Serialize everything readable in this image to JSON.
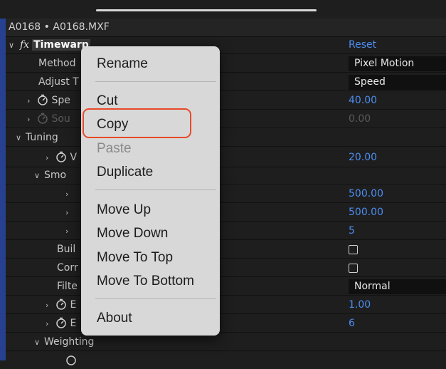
{
  "header": {
    "title": "A0168 • A0168.MXF"
  },
  "effect": {
    "fx_icon": "fx",
    "name": "Timewarp",
    "reset_label": "Reset"
  },
  "props": {
    "method": {
      "label": "Method",
      "value": "Pixel Motion"
    },
    "adjust": {
      "label": "Adjust T",
      "value": "Speed"
    },
    "speed": {
      "label": "Spe",
      "value": "40.00"
    },
    "source": {
      "label": "Sou",
      "value": "0.00"
    },
    "tuning": {
      "label": "Tuning"
    },
    "vector": {
      "label": "V",
      "value": "20.00"
    },
    "smooth": {
      "label": "Smo"
    },
    "sm1": {
      "value": "500.00"
    },
    "sm2": {
      "value": "500.00"
    },
    "sm3": {
      "value": "5"
    },
    "build": {
      "label": "Buil"
    },
    "correct": {
      "label": "Corr"
    },
    "filter": {
      "label": "Filte",
      "value": "Normal"
    },
    "e1": {
      "label": "E",
      "value": "1.00"
    },
    "e2": {
      "label": "E",
      "value": "6"
    },
    "weighting": {
      "label": "Weighting"
    }
  },
  "context_menu": {
    "rename": "Rename",
    "cut": "Cut",
    "copy": "Copy",
    "paste": "Paste",
    "duplicate": "Duplicate",
    "move_up": "Move Up",
    "move_down": "Move Down",
    "move_top": "Move To Top",
    "move_bottom": "Move To Bottom",
    "about": "About"
  },
  "colors": {
    "accent": "#4d8ef2",
    "highlight": "#e84a2a"
  }
}
